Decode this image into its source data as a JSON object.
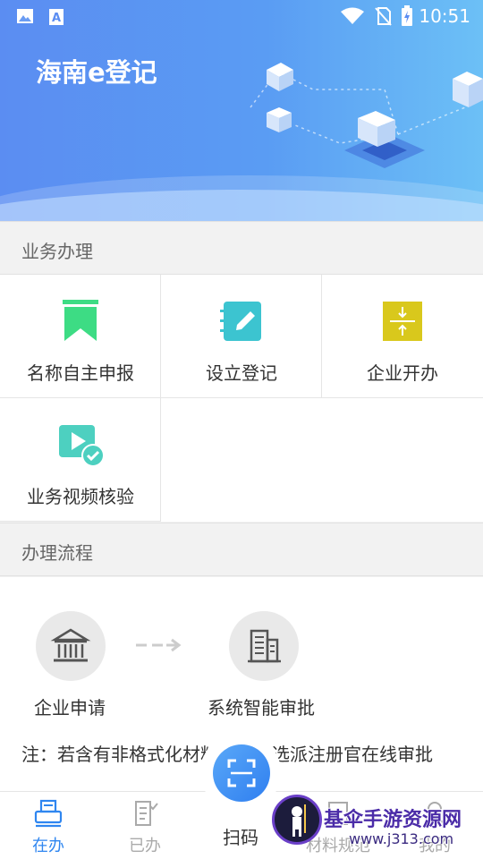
{
  "status_bar": {
    "time": "10:51"
  },
  "header": {
    "title": "海南e登记"
  },
  "sections": {
    "business": "业务办理",
    "process": "办理流程"
  },
  "services": [
    {
      "label": "名称自主申报",
      "icon": "bookmark-icon",
      "color": "#3ddc84"
    },
    {
      "label": "设立登记",
      "icon": "notebook-edit-icon",
      "color": "#3cc4d0"
    },
    {
      "label": "企业开办",
      "icon": "merge-icon",
      "color": "#d9c81c"
    },
    {
      "label": "业务视频核验",
      "icon": "video-check-icon",
      "color": "#4dd0c0"
    }
  ],
  "flow": {
    "steps": [
      {
        "label": "企业申请",
        "icon": "bank-icon"
      },
      {
        "label": "系统智能审批",
        "icon": "building-icon"
      }
    ],
    "note": "注：若含有非格式化材料则随机选派注册官在线审批"
  },
  "bottom_nav": {
    "items": [
      {
        "label": "在办",
        "icon": "printer-icon",
        "active": true
      },
      {
        "label": "已办",
        "icon": "document-check-icon",
        "active": false
      },
      {
        "label": "材料规范",
        "icon": "guide-icon",
        "active": false
      },
      {
        "label": "我的",
        "icon": "user-icon",
        "active": false
      }
    ],
    "scan_label": "扫码"
  },
  "watermark": {
    "title": "基伞手游资源网",
    "url": "www.j313.com"
  }
}
